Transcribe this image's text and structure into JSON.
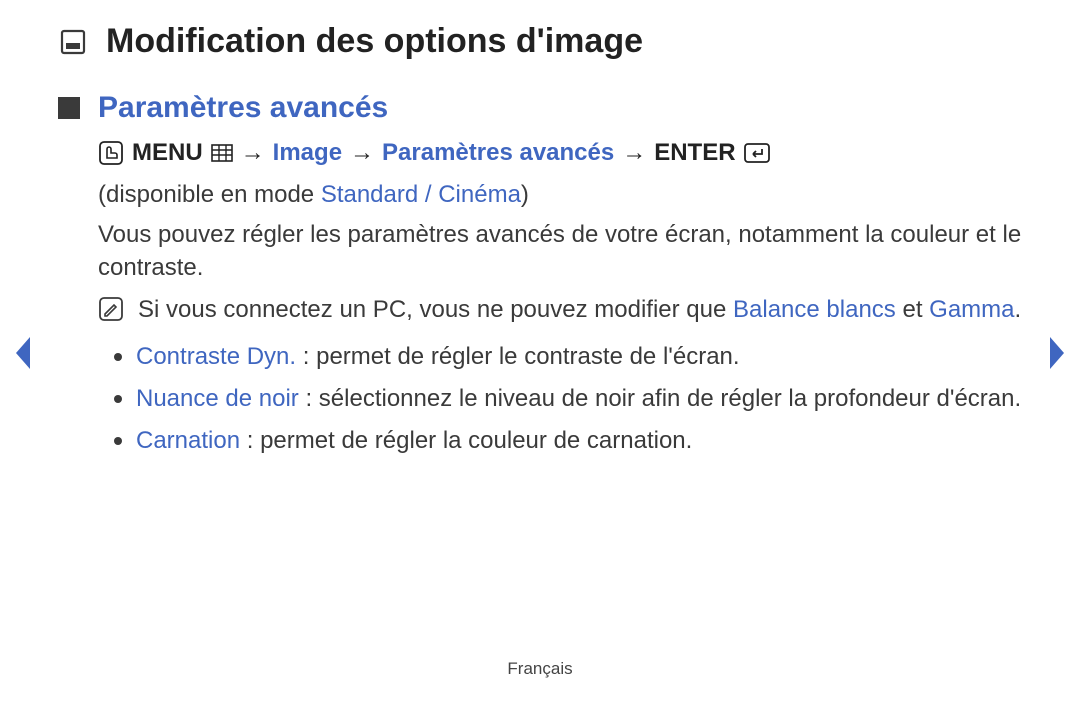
{
  "title": "Modification des options d'image",
  "section_heading": "Paramètres avancés",
  "breadcrumb": {
    "menu_label": "MENU",
    "arrow": "→",
    "image_label": "Image",
    "advanced_label": "Paramètres avancés",
    "enter_label": "ENTER"
  },
  "availability": {
    "prefix": "(disponible en mode ",
    "modes": "Standard / Cinéma",
    "suffix": ")"
  },
  "intro": "Vous pouvez régler les paramètres avancés de votre écran, notamment la couleur et le contraste.",
  "note": {
    "part1": "Si vous connectez un PC, vous ne pouvez modifier que ",
    "term1": "Balance blancs",
    "connector": " et ",
    "term2": "Gamma",
    "end": "."
  },
  "bullets": [
    {
      "label": "Contraste Dyn.",
      "sep": " : ",
      "desc": "permet de régler le contraste de l'écran."
    },
    {
      "label": "Nuance de noir",
      "sep": " : ",
      "desc": "sélectionnez le niveau de noir afin de régler la profondeur d'écran."
    },
    {
      "label": "Carnation",
      "sep": " : ",
      "desc": "permet de régler la couleur de carnation."
    }
  ],
  "footer": "Français"
}
